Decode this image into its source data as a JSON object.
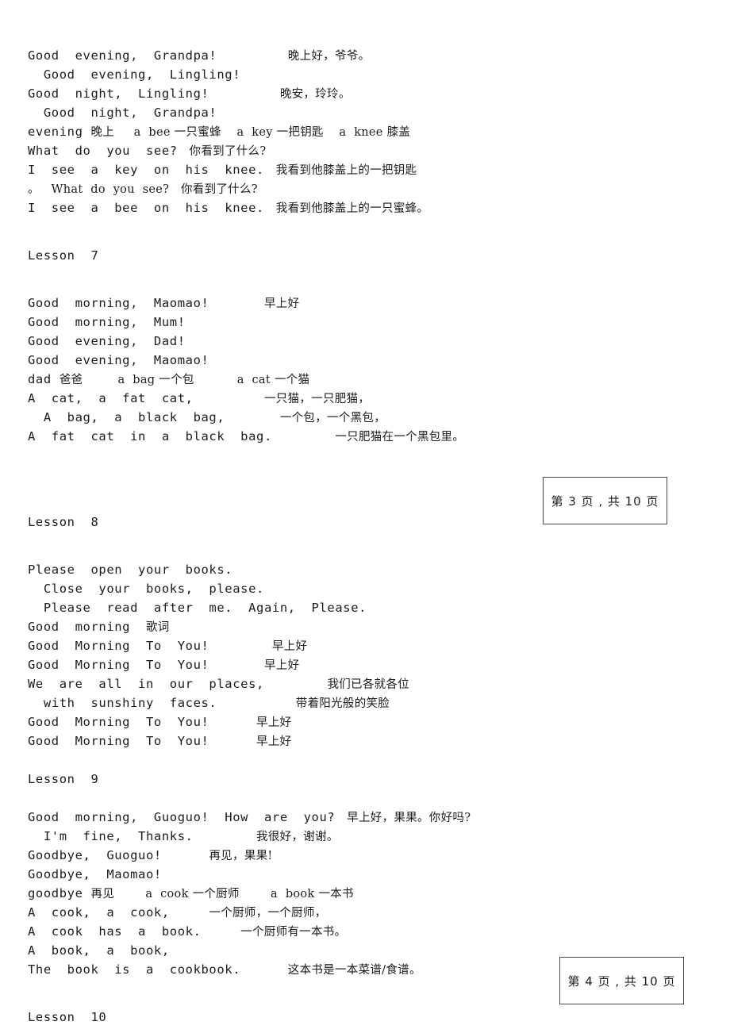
{
  "document": {
    "page_boxes": [
      {
        "label": "第 3 页 , 共 10 页"
      },
      {
        "label": "第 4 页 , 共 10 页"
      }
    ],
    "lines": [
      {
        "en": "Good  evening,  Grandpa!",
        "zh": "晚上好，爷爷。",
        "pad": 0,
        "gap": 9
      },
      {
        "en": "  Good  evening,  Lingling!",
        "zh": "",
        "pad": 0,
        "gap": 0
      },
      {
        "en": "Good  night,  Lingling!",
        "zh": "晚安，玲玲。",
        "pad": 0,
        "gap": 9
      },
      {
        "en": "  Good  night,  Grandpa!",
        "zh": "",
        "pad": 0,
        "gap": 0
      },
      {
        "en": "evening ",
        "zh": "晚上     a  bee 一只蜜蜂    a  key 一把钥匙    a  knee 膝盖",
        "pad": 0,
        "gap": 0
      },
      {
        "en": "What  do  you  see? ",
        "zh": " 你看到了什么?",
        "pad": 0,
        "gap": 0
      },
      {
        "en": "I  see  a  key  on  his  knee. ",
        "zh": " 我看到他膝盖上的一把钥匙",
        "pad": 0,
        "gap": 0
      },
      {
        "en": "",
        "zh": "。",
        "pad": 0,
        "gap": 0,
        "mixed": "。   What  do  you  see?   你看到了什么?"
      },
      {
        "en": "I  see  a  bee  on  his  knee. ",
        "zh": " 我看到他膝盖上的一只蜜蜂。",
        "pad": 0,
        "gap": 0
      }
    ],
    "lesson7": {
      "heading": "Lesson  7",
      "lines": [
        {
          "en": "Good  morning,  Maomao!",
          "zh": "早上好",
          "gap": 7
        },
        {
          "en": "Good  morning,  Mum!",
          "zh": "",
          "gap": 0
        },
        {
          "en": "Good  evening,  Dad!",
          "zh": "",
          "gap": 0
        },
        {
          "en": "Good  evening,  Maomao!",
          "zh": "",
          "gap": 0
        },
        {
          "en": "dad ",
          "zh": "爸爸         a  bag 一个包           a  cat 一个猫",
          "gap": 0
        },
        {
          "en": "A  cat,  a  fat  cat,",
          "zh": "一只猫，一只肥猫，",
          "gap": 9
        },
        {
          "en": "  A  bag,  a  black  bag,",
          "zh": "一个包，一个黑包，",
          "gap": 7
        },
        {
          "en": "A  fat  cat  in  a  black  bag.",
          "zh": "一只肥猫在一个黑包里。",
          "gap": 8
        }
      ]
    },
    "lesson8": {
      "heading": "Lesson  8",
      "lines": [
        {
          "en": "Please  open  your  books.",
          "zh": "",
          "gap": 0
        },
        {
          "en": "  Close  your  books,  please.",
          "zh": "",
          "gap": 0
        },
        {
          "en": "  Please  read  after  me.  Again,  Please.",
          "zh": "",
          "gap": 0
        },
        {
          "en": "Good  morning  ",
          "zh": "歌词",
          "gap": 0
        },
        {
          "en": "Good  Morning  To  You!",
          "zh": "早上好",
          "gap": 8
        },
        {
          "en": "Good  Morning  To  You!",
          "zh": "早上好",
          "gap": 7
        },
        {
          "en": "We  are  all  in  our  places,",
          "zh": "我们已各就各位",
          "gap": 8
        },
        {
          "en": "  with  sunshiny  faces.",
          "zh": "带着阳光般的笑脸",
          "gap": 10
        },
        {
          "en": "Good  Morning  To  You!",
          "zh": "早上好",
          "gap": 6
        },
        {
          "en": "Good  Morning  To  You!",
          "zh": "早上好",
          "gap": 6
        }
      ]
    },
    "lesson9": {
      "heading": "Lesson  9",
      "lines": [
        {
          "en": "Good  morning,  Guoguo!  How  are  you? ",
          "zh": " 早上好，果果。你好吗?",
          "gap": 0
        },
        {
          "en": "  I'm  fine,  Thanks.",
          "zh": "我很好，谢谢。",
          "gap": 8
        },
        {
          "en": "Goodbye,  Guoguo!",
          "zh": "再见，果果!",
          "gap": 6
        },
        {
          "en": "Goodbye,  Maomao!",
          "zh": "",
          "gap": 0
        },
        {
          "en": "goodbye ",
          "zh": "再见        a  cook 一个厨师        a  book 一本书",
          "gap": 0
        },
        {
          "en": "A  cook,  a  cook,",
          "zh": "一个厨师，一个厨师，",
          "gap": 5
        },
        {
          "en": "A  cook  has  a  book.",
          "zh": "一个厨师有一本书。",
          "gap": 5
        },
        {
          "en": "A  book,  a  book,",
          "zh": "",
          "gap": 0
        },
        {
          "en": "The  book  is  a  cookbook.",
          "zh": "这本书是一本菜谱/食谱。",
          "gap": 6
        }
      ]
    },
    "lesson10": {
      "heading": "Lesson  10"
    }
  }
}
